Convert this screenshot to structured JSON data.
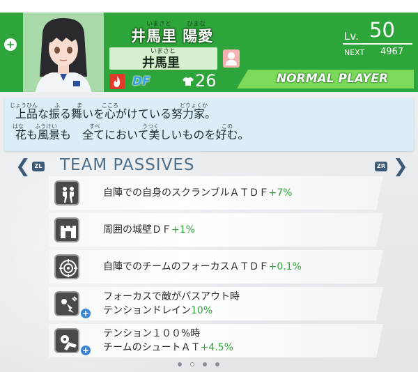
{
  "player": {
    "full_name": "井馬里 陽愛",
    "full_name_ruby_surname": "いまさと",
    "full_name_ruby_given": "ひまな",
    "short_name": "井馬里",
    "short_name_ruby": "いまさと",
    "position": "DF",
    "number": "26",
    "level_label": "Lv.",
    "level": "50",
    "next_label": "NEXT",
    "next_exp": "4967",
    "type": "NORMAL PLAYER"
  },
  "description": {
    "line1": "上品な振る舞いを心がけている努力家。",
    "line2": "花も風景も　全てにおいて美しいものを好む。",
    "ruby": [
      "じょうひん",
      "ふ",
      "ま",
      "こころ",
      "どりょくか",
      "はな",
      "ふうけい",
      "すべ",
      "うつく",
      "この"
    ]
  },
  "passives": {
    "title": "TEAM PASSIVES",
    "nav_left_tag": "ZL",
    "nav_right_tag": "ZR",
    "items": [
      {
        "text": "自陣での自身のスクランブルＡＴＤＦ",
        "value": "+7%"
      },
      {
        "text": "周囲の城壁ＤＦ",
        "value": "+1%"
      },
      {
        "text": "自陣でのチームのフォーカスＡＴＤＦ",
        "value": "+0.1%"
      },
      {
        "line1": "フォーカスで敵がパスアウト時",
        "line2": "テンションドレイン",
        "value": "10%"
      },
      {
        "line1": "テンション１００%時",
        "line2": "チームのシュートＡＴ",
        "value": "+4.5%"
      }
    ]
  },
  "pagination": {
    "total": 4,
    "active": 1
  },
  "colors": {
    "header": "#2ea53a",
    "value": "#2ea53a",
    "desc_bg": "#dbeef8",
    "accent": "#3b5a78"
  }
}
